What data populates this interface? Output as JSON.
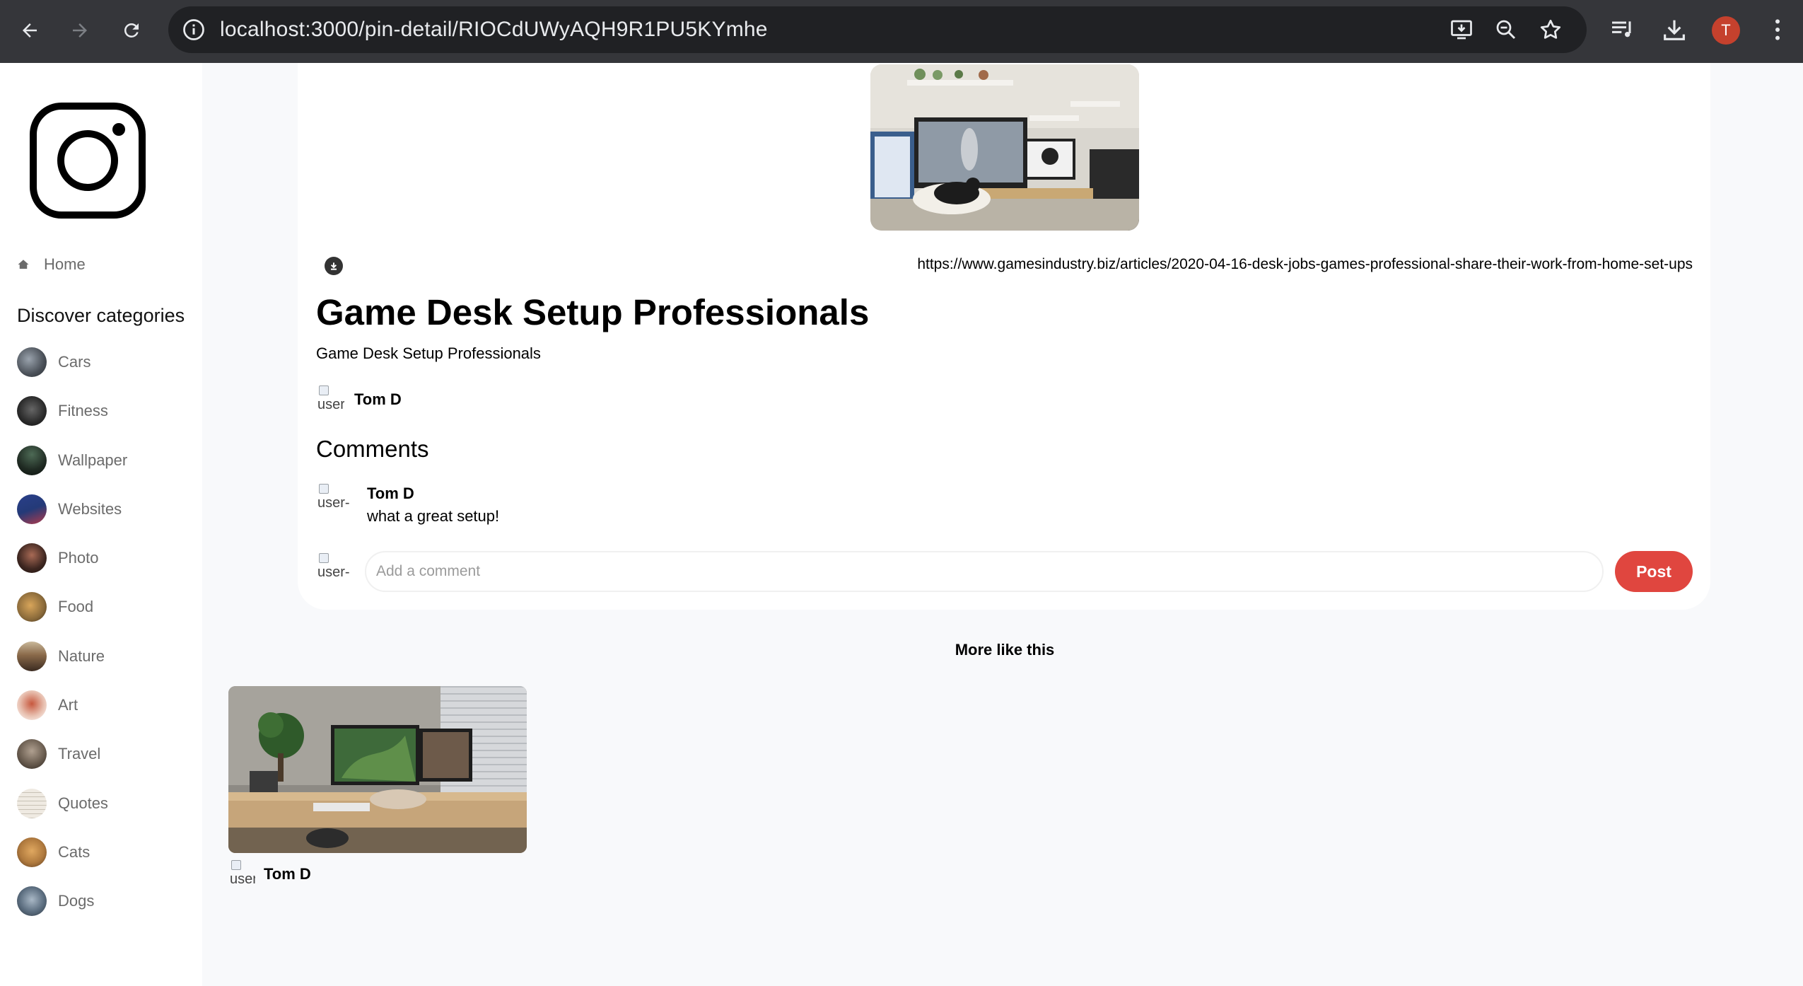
{
  "browser": {
    "url": "localhost:3000/pin-detail/RIOCdUWyAQH9R1PU5KYmhe",
    "profile_initial": "T",
    "icons": [
      "back-icon",
      "forward-icon",
      "reload-icon",
      "site-info-icon",
      "install-app-icon",
      "zoom-icon",
      "bookmark-star-icon",
      "media-queue-icon",
      "downloads-icon",
      "profile-avatar",
      "menu-kebab-icon"
    ]
  },
  "sidebar": {
    "home_label": "Home",
    "discover_title": "Discover categories",
    "categories": [
      {
        "label": "Cars",
        "color": "#4a5058"
      },
      {
        "label": "Fitness",
        "color": "#2a2a2a"
      },
      {
        "label": "Wallpaper",
        "color": "#1f2a22"
      },
      {
        "label": "Websites",
        "color": "#243a78"
      },
      {
        "label": "Photo",
        "color": "#3d2620"
      },
      {
        "label": "Food",
        "color": "#8a6a3a"
      },
      {
        "label": "Nature",
        "color": "#5a4a3a"
      },
      {
        "label": "Art",
        "color": "#c7583e"
      },
      {
        "label": "Travel",
        "color": "#6a5d50"
      },
      {
        "label": "Quotes",
        "color": "#e8e3da"
      },
      {
        "label": "Cats",
        "color": "#b07a3e"
      },
      {
        "label": "Dogs",
        "color": "#5c6e80"
      }
    ]
  },
  "pin": {
    "destination": "https://www.gamesindustry.biz/articles/2020-04-16-desk-jobs-games-professional-share-their-work-from-home-set-ups",
    "title": "Game Desk Setup Professionals",
    "about": "Game Desk Setup Professionals",
    "posted_by": "Tom D",
    "avatar_alt": "user-"
  },
  "comments": {
    "heading": "Comments",
    "items": [
      {
        "name": "Tom D",
        "text": "what a great setup!",
        "avatar_alt": "user-"
      }
    ],
    "input_placeholder": "Add a comment",
    "input_avatar_alt": "user-",
    "post_label": "Post"
  },
  "more": {
    "heading": "More like this",
    "pins": [
      {
        "user": "Tom D",
        "avatar_alt": "user"
      }
    ]
  },
  "colors": {
    "post_button": "#e0463f",
    "chrome_bar": "#35363a",
    "omnibox": "#202124",
    "page_bg": "#f8f9fb"
  }
}
